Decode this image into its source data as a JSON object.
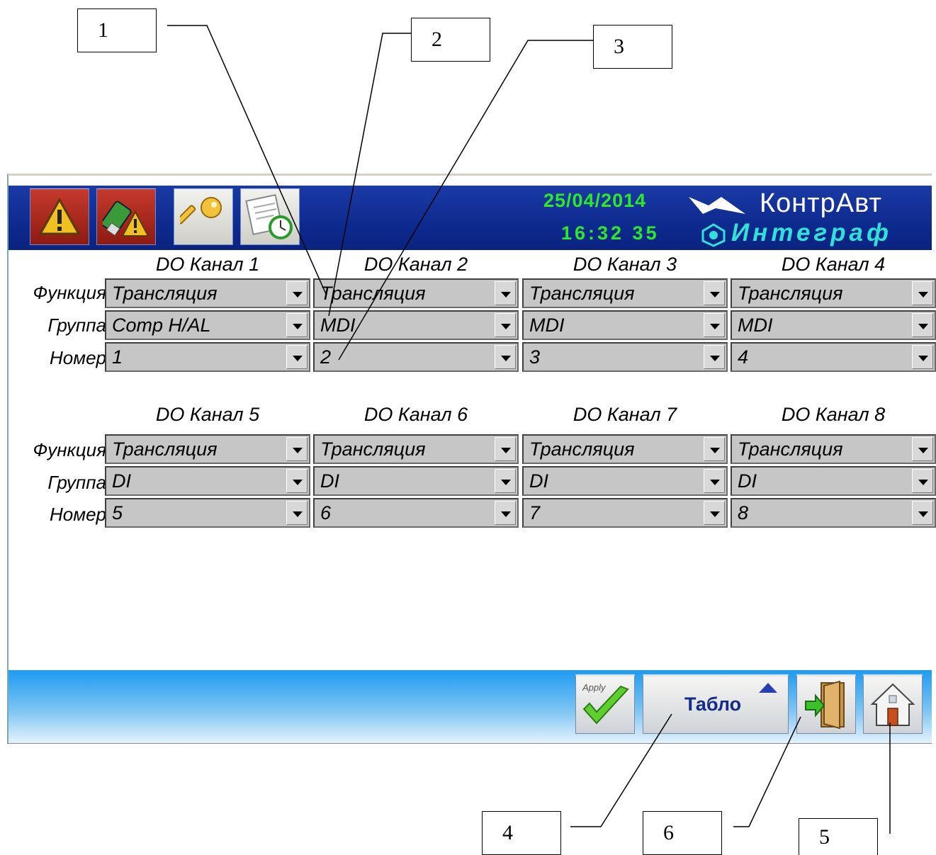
{
  "callouts": [
    "1",
    "2",
    "3",
    "4",
    "5",
    "6"
  ],
  "header": {
    "date": "25/04/2014",
    "time": "16:32 35",
    "logo_top": "КонтрАвт",
    "logo_bottom": "Интеграф",
    "toolbar": [
      {
        "icon": "warning-icon"
      },
      {
        "icon": "usb-warning-icon"
      },
      {
        "icon": "key-icon"
      },
      {
        "icon": "schedule-clock-icon"
      }
    ]
  },
  "row_labels": {
    "function": "Функция",
    "group": "Группа",
    "number": "Номер"
  },
  "channels": [
    {
      "title": "DO Канал 1",
      "function": "Трансляция",
      "group": "Comp H/AL",
      "number": "1"
    },
    {
      "title": "DO Канал 2",
      "function": "Трансляция",
      "group": "MDI",
      "number": "2"
    },
    {
      "title": "DO Канал 3",
      "function": "Трансляция",
      "group": "MDI",
      "number": "3"
    },
    {
      "title": "DO Канал 4",
      "function": "Трансляция",
      "group": "MDI",
      "number": "4"
    },
    {
      "title": "DO Канал 5",
      "function": "Трансляция",
      "group": "DI",
      "number": "5"
    },
    {
      "title": "DO Канал 6",
      "function": "Трансляция",
      "group": "DI",
      "number": "6"
    },
    {
      "title": "DO Канал 7",
      "function": "Трансляция",
      "group": "DI",
      "number": "7"
    },
    {
      "title": "DO Канал 8",
      "function": "Трансляция",
      "group": "DI",
      "number": "8"
    }
  ],
  "footer": {
    "apply_label": "Apply",
    "tablo_label": "Табло",
    "exit_icon": "exit-door-icon",
    "home_icon": "home-icon"
  },
  "colors": {
    "header_bg": "#0d2a8f",
    "clock": "#2be82b",
    "logo_accent": "#31e0d8",
    "combo_bg": "#c6c6c6"
  }
}
